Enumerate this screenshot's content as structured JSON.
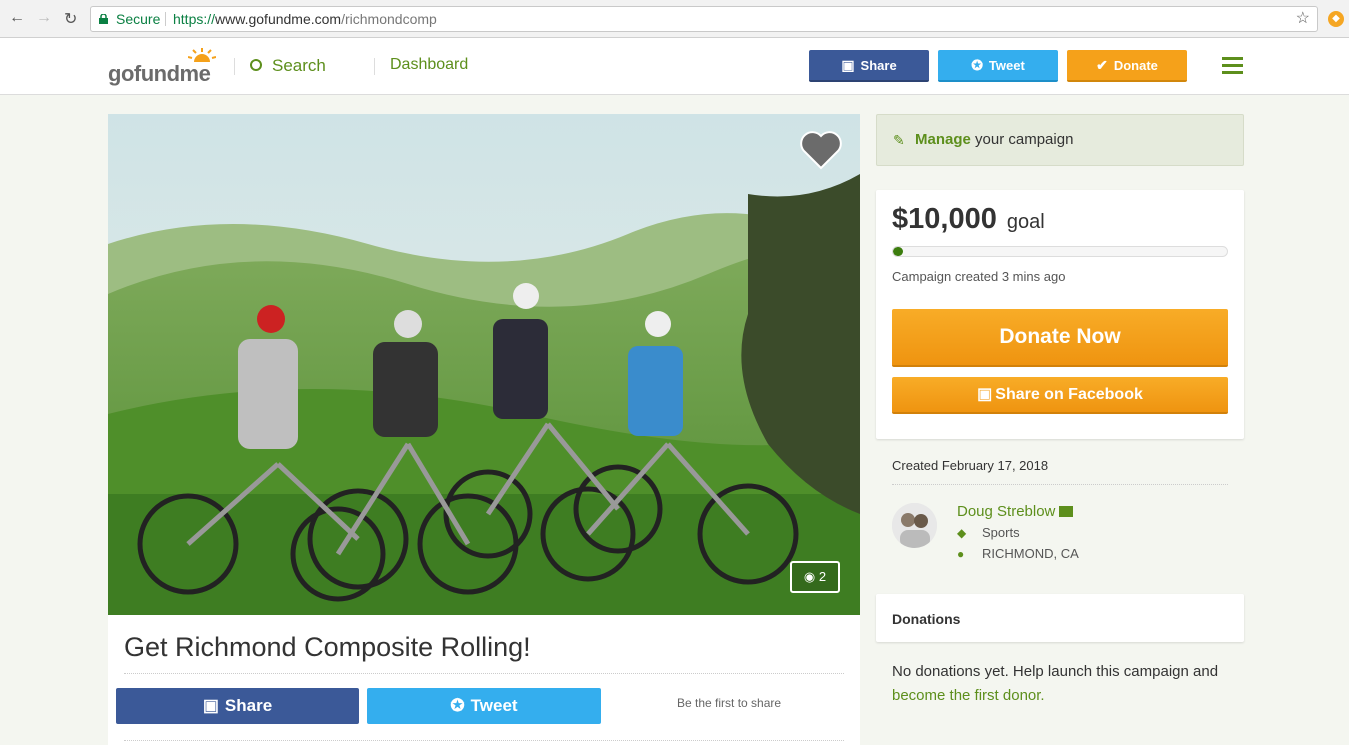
{
  "browser": {
    "secure_label": "Secure",
    "url_scheme": "https://",
    "url_host": "www.gofundme.com",
    "url_path": "/richmondcomp"
  },
  "header": {
    "logo_text_1": "go",
    "logo_text_2": "fund",
    "logo_text_3": "me",
    "search_label": "Search",
    "dashboard_label": "Dashboard",
    "share_label": "Share",
    "tweet_label": "Tweet",
    "donate_label": "Donate"
  },
  "campaign": {
    "photo_count": "2",
    "title": "Get Richmond Composite Rolling!",
    "share_label": "Share",
    "tweet_label": "Tweet",
    "first_share_text": "Be the first to share"
  },
  "sidebar": {
    "manage_bold": "Manage",
    "manage_rest": " your campaign",
    "goal_amount": "$10,000",
    "goal_label": "goal",
    "progress_fraction": 0.03,
    "created_ago": "Campaign created 3 mins ago",
    "donate_now_label": "Donate Now",
    "share_facebook_label": "Share on Facebook",
    "created_date": "Created February 17, 2018",
    "organizer_name": "Doug Streblow",
    "category": "Sports",
    "location": "RICHMOND, CA",
    "donations_title": "Donations",
    "no_donations_text": "No donations yet. Help launch this campaign and ",
    "first_donor_link": "become the first donor."
  },
  "colors": {
    "brand_green": "#5d8f1c",
    "facebook_blue": "#3b5998",
    "twitter_blue": "#34aeee",
    "donate_orange": "#f5a11a"
  }
}
